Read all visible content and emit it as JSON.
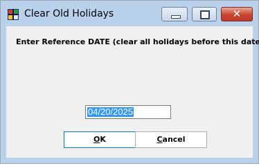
{
  "window": {
    "title": "Clear Old Holidays",
    "app_icon": "flag-grid-icon",
    "controls": {
      "minimize_icon": "minimize-icon",
      "maximize_icon": "maximize-icon",
      "close_icon": "close-icon",
      "close_glyph": "✕"
    }
  },
  "dialog": {
    "prompt": "Enter Reference DATE (clear all holidays before this date)",
    "date_value": "04/20/2025",
    "ok_mnemonic": "O",
    "ok_rest": "K",
    "cancel_mnemonic": "C",
    "cancel_rest": "ancel"
  },
  "colors": {
    "frame": "#b9d1ea",
    "client": "#f0f0f0",
    "selection": "#3399ff",
    "close_button": "#c8452f"
  }
}
